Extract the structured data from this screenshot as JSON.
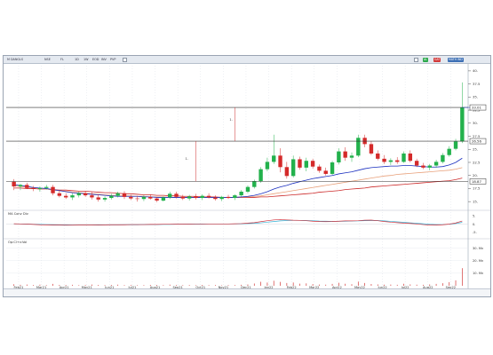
{
  "toolbar": {
    "symbol": "M DANGLS",
    "exchange": "NSE",
    "timeframe": "FL",
    "opts": [
      "1D",
      "1W",
      "EOD",
      "INV",
      "PVP"
    ],
    "badges": [
      {
        "label": "AL",
        "color": "#2aa84a"
      },
      {
        "label": "GAT",
        "color": "#d23a3a"
      },
      {
        "label": "MATH IND",
        "color": "#3c6fb5"
      }
    ]
  },
  "chart_data": {
    "type": "candlestick",
    "months": [
      "Feb21",
      "Mar21",
      "Apr21",
      "May21",
      "Jun21",
      "Jul21",
      "Aug21",
      "Sep21",
      "Oct21",
      "Nov21",
      "Dec21",
      "Jan22",
      "Feb22",
      "Mar22",
      "Apr22",
      "May22",
      "Jun22",
      "Jul22",
      "Aug22",
      "Sep22"
    ],
    "price_ticks": [
      "40.",
      "37.5",
      "35.",
      "32.5",
      "30.",
      "27.5",
      "25.",
      "22.5",
      "20.",
      "17.5",
      "15."
    ],
    "price_labels": [
      {
        "text": "33.01",
        "color": "#1a1a1a"
      },
      {
        "text": "26.56",
        "color": "#1a1a1a"
      },
      {
        "text": "18.87",
        "color": "#1a1a1a"
      }
    ],
    "candles": [
      {
        "o": 18.8,
        "h": 19.3,
        "l": 17.2,
        "c": 17.9
      },
      {
        "o": 17.9,
        "h": 18.4,
        "l": 17.2,
        "c": 18.2
      },
      {
        "o": 18.2,
        "h": 18.6,
        "l": 17.4,
        "c": 17.6
      },
      {
        "o": 17.6,
        "h": 18.0,
        "l": 17.0,
        "c": 17.4
      },
      {
        "o": 17.4,
        "h": 17.9,
        "l": 16.9,
        "c": 17.6
      },
      {
        "o": 17.6,
        "h": 18.2,
        "l": 17.3,
        "c": 17.8
      },
      {
        "o": 17.8,
        "h": 18.2,
        "l": 16.2,
        "c": 16.6
      },
      {
        "o": 16.6,
        "h": 17.1,
        "l": 15.8,
        "c": 16.1
      },
      {
        "o": 16.1,
        "h": 16.6,
        "l": 15.5,
        "c": 15.8
      },
      {
        "o": 15.8,
        "h": 16.6,
        "l": 15.3,
        "c": 16.2
      },
      {
        "o": 16.2,
        "h": 16.9,
        "l": 15.8,
        "c": 16.6
      },
      {
        "o": 16.6,
        "h": 17.0,
        "l": 15.9,
        "c": 16.2
      },
      {
        "o": 16.2,
        "h": 16.8,
        "l": 15.4,
        "c": 15.8
      },
      {
        "o": 15.8,
        "h": 16.4,
        "l": 15.0,
        "c": 15.4
      },
      {
        "o": 15.4,
        "h": 16.0,
        "l": 15.0,
        "c": 15.7
      },
      {
        "o": 15.7,
        "h": 16.5,
        "l": 15.4,
        "c": 16.1
      },
      {
        "o": 16.1,
        "h": 16.9,
        "l": 15.8,
        "c": 16.6
      },
      {
        "o": 16.6,
        "h": 17.0,
        "l": 15.5,
        "c": 15.9
      },
      {
        "o": 15.9,
        "h": 16.3,
        "l": 15.3,
        "c": 15.6
      },
      {
        "o": 15.6,
        "h": 16.1,
        "l": 15.0,
        "c": 15.5
      },
      {
        "o": 15.5,
        "h": 16.2,
        "l": 15.1,
        "c": 15.9
      },
      {
        "o": 15.9,
        "h": 16.4,
        "l": 15.4,
        "c": 15.6
      },
      {
        "o": 15.6,
        "h": 15.9,
        "l": 14.9,
        "c": 15.2
      },
      {
        "o": 15.2,
        "h": 16.0,
        "l": 15.0,
        "c": 15.8
      },
      {
        "o": 15.8,
        "h": 16.9,
        "l": 15.5,
        "c": 16.5
      },
      {
        "o": 16.5,
        "h": 16.9,
        "l": 15.6,
        "c": 15.9
      },
      {
        "o": 15.9,
        "h": 16.3,
        "l": 15.3,
        "c": 15.6
      },
      {
        "o": 15.6,
        "h": 16.3,
        "l": 15.2,
        "c": 16.0
      },
      {
        "o": 16.0,
        "h": 16.5,
        "l": 15.4,
        "c": 15.7
      },
      {
        "o": 15.7,
        "h": 16.4,
        "l": 15.3,
        "c": 16.1
      },
      {
        "o": 16.1,
        "h": 16.6,
        "l": 15.6,
        "c": 15.8
      },
      {
        "o": 15.8,
        "h": 16.2,
        "l": 15.2,
        "c": 15.5
      },
      {
        "o": 15.5,
        "h": 16.1,
        "l": 15.1,
        "c": 15.9
      },
      {
        "o": 15.9,
        "h": 16.3,
        "l": 15.5,
        "c": 15.7
      },
      {
        "o": 15.7,
        "h": 16.4,
        "l": 15.3,
        "c": 16.2
      },
      {
        "o": 16.2,
        "h": 17.2,
        "l": 15.9,
        "c": 16.9
      },
      {
        "o": 16.9,
        "h": 18.1,
        "l": 16.6,
        "c": 17.8
      },
      {
        "o": 17.8,
        "h": 19.2,
        "l": 17.5,
        "c": 18.9
      },
      {
        "o": 18.9,
        "h": 21.6,
        "l": 18.6,
        "c": 21.2
      },
      {
        "o": 21.2,
        "h": 23.4,
        "l": 20.8,
        "c": 22.6
      },
      {
        "o": 22.6,
        "h": 27.8,
        "l": 22.2,
        "c": 23.8
      },
      {
        "o": 23.8,
        "h": 25.2,
        "l": 20.6,
        "c": 21.6
      },
      {
        "o": 21.6,
        "h": 22.6,
        "l": 19.4,
        "c": 19.9
      },
      {
        "o": 19.9,
        "h": 23.8,
        "l": 19.6,
        "c": 23.1
      },
      {
        "o": 23.1,
        "h": 23.6,
        "l": 21.1,
        "c": 21.5
      },
      {
        "o": 21.5,
        "h": 23.4,
        "l": 20.8,
        "c": 22.8
      },
      {
        "o": 22.8,
        "h": 23.2,
        "l": 21.3,
        "c": 21.7
      },
      {
        "o": 21.7,
        "h": 22.1,
        "l": 20.5,
        "c": 20.9
      },
      {
        "o": 20.9,
        "h": 21.5,
        "l": 20.0,
        "c": 20.3
      },
      {
        "o": 20.3,
        "h": 22.8,
        "l": 20.1,
        "c": 22.5
      },
      {
        "o": 22.5,
        "h": 25.2,
        "l": 22.1,
        "c": 24.6
      },
      {
        "o": 24.6,
        "h": 25.4,
        "l": 22.8,
        "c": 23.4
      },
      {
        "o": 23.4,
        "h": 24.4,
        "l": 22.6,
        "c": 23.8
      },
      {
        "o": 23.8,
        "h": 27.8,
        "l": 23.5,
        "c": 27.2
      },
      {
        "o": 27.2,
        "h": 27.8,
        "l": 25.4,
        "c": 26.0
      },
      {
        "o": 26.0,
        "h": 26.5,
        "l": 23.9,
        "c": 24.2
      },
      {
        "o": 24.2,
        "h": 24.8,
        "l": 22.9,
        "c": 23.2
      },
      {
        "o": 23.2,
        "h": 23.9,
        "l": 22.2,
        "c": 22.6
      },
      {
        "o": 22.6,
        "h": 23.3,
        "l": 22.0,
        "c": 22.9
      },
      {
        "o": 22.9,
        "h": 23.5,
        "l": 22.2,
        "c": 22.6
      },
      {
        "o": 22.6,
        "h": 24.6,
        "l": 22.4,
        "c": 24.2
      },
      {
        "o": 24.2,
        "h": 24.8,
        "l": 22.5,
        "c": 22.8
      },
      {
        "o": 22.8,
        "h": 23.2,
        "l": 21.6,
        "c": 21.9
      },
      {
        "o": 21.9,
        "h": 22.4,
        "l": 21.2,
        "c": 21.5
      },
      {
        "o": 21.5,
        "h": 22.2,
        "l": 21.0,
        "c": 21.9
      },
      {
        "o": 21.9,
        "h": 23.0,
        "l": 21.5,
        "c": 22.6
      },
      {
        "o": 22.6,
        "h": 24.3,
        "l": 22.3,
        "c": 23.9
      },
      {
        "o": 23.9,
        "h": 25.6,
        "l": 23.6,
        "c": 25.1
      },
      {
        "o": 25.1,
        "h": 27.0,
        "l": 24.8,
        "c": 26.5
      },
      {
        "o": 26.5,
        "h": 37.8,
        "l": 26.2,
        "c": 33.0
      }
    ],
    "ma_fast": [
      18.2,
      18.1,
      17.9,
      17.7,
      17.6,
      17.5,
      17.3,
      17.1,
      16.9,
      16.7,
      16.6,
      16.5,
      16.4,
      16.3,
      16.2,
      16.1,
      16.0,
      16.0,
      16.0,
      16.0,
      15.9,
      15.9,
      15.8,
      15.8,
      15.8,
      15.8,
      15.8,
      15.8,
      15.8,
      15.8,
      15.8,
      15.8,
      15.8,
      15.8,
      15.8,
      15.9,
      16.0,
      16.2,
      16.5,
      16.9,
      17.4,
      17.8,
      18.1,
      18.5,
      18.8,
      19.1,
      19.4,
      19.6,
      19.8,
      20.0,
      20.3,
      20.5,
      20.7,
      21.0,
      21.3,
      21.5,
      21.6,
      21.7,
      21.8,
      21.8,
      21.9,
      21.9,
      21.8,
      21.7,
      21.6,
      21.6,
      21.7,
      22.0,
      22.5,
      23.3
    ],
    "ma_slow": [
      18.0,
      17.9,
      17.8,
      17.6,
      17.5,
      17.4,
      17.2,
      17.1,
      17.0,
      16.8,
      16.7,
      16.6,
      16.5,
      16.4,
      16.3,
      16.2,
      16.2,
      16.1,
      16.1,
      16.0,
      16.0,
      15.9,
      15.9,
      15.9,
      15.8,
      15.8,
      15.8,
      15.8,
      15.8,
      15.8,
      15.8,
      15.8,
      15.8,
      15.8,
      15.8,
      15.9,
      15.9,
      16.0,
      16.1,
      16.3,
      16.5,
      16.7,
      16.9,
      17.1,
      17.3,
      17.5,
      17.7,
      17.9,
      18.1,
      18.3,
      18.5,
      18.7,
      18.9,
      19.1,
      19.3,
      19.5,
      19.7,
      19.9,
      20.0,
      20.2,
      20.3,
      20.4,
      20.5,
      20.6,
      20.7,
      20.8,
      20.9,
      21.0,
      21.2,
      21.5
    ],
    "ma_long": [
      17.6,
      17.6,
      17.5,
      17.5,
      17.4,
      17.4,
      17.3,
      17.2,
      17.2,
      17.1,
      17.0,
      17.0,
      16.9,
      16.8,
      16.7,
      16.7,
      16.6,
      16.5,
      16.5,
      16.4,
      16.3,
      16.3,
      16.2,
      16.2,
      16.1,
      16.1,
      16.0,
      16.0,
      16.0,
      15.9,
      15.9,
      15.9,
      15.8,
      15.8,
      15.8,
      15.8,
      15.8,
      15.8,
      15.9,
      15.9,
      16.0,
      16.1,
      16.2,
      16.3,
      16.4,
      16.5,
      16.6,
      16.8,
      16.9,
      17.0,
      17.1,
      17.3,
      17.4,
      17.5,
      17.6,
      17.8,
      17.9,
      18.0,
      18.1,
      18.2,
      18.3,
      18.4,
      18.5,
      18.6,
      18.7,
      18.8,
      18.9,
      19.0,
      19.2,
      19.5
    ],
    "osc_label": "MA Conv Div",
    "osc_ticks": [
      "5.",
      "0.",
      "-5."
    ],
    "osc_line1": [
      0.2,
      0.1,
      0.0,
      -0.2,
      -0.4,
      -0.5,
      -0.6,
      -0.6,
      -0.7,
      -0.7,
      -0.6,
      -0.6,
      -0.6,
      -0.5,
      -0.5,
      -0.4,
      -0.4,
      -0.4,
      -0.3,
      -0.3,
      -0.3,
      -0.2,
      -0.2,
      -0.1,
      -0.1,
      0.0,
      0.0,
      0.0,
      0.1,
      0.1,
      0.1,
      0.1,
      0.1,
      0.1,
      0.2,
      0.3,
      0.6,
      0.9,
      1.5,
      2.1,
      2.6,
      2.8,
      2.6,
      2.4,
      2.3,
      2.1,
      1.8,
      1.6,
      1.5,
      1.6,
      1.8,
      2.0,
      2.0,
      2.1,
      2.4,
      2.5,
      2.1,
      1.6,
      1.2,
      0.9,
      0.6,
      0.4,
      0.1,
      -0.3,
      -0.6,
      -0.6,
      -0.4,
      0.0,
      0.7,
      1.9
    ],
    "osc_line2": [
      0.1,
      0.1,
      0.0,
      -0.1,
      -0.2,
      -0.3,
      -0.4,
      -0.5,
      -0.5,
      -0.6,
      -0.6,
      -0.6,
      -0.6,
      -0.6,
      -0.5,
      -0.5,
      -0.5,
      -0.4,
      -0.4,
      -0.4,
      -0.3,
      -0.3,
      -0.3,
      -0.2,
      -0.2,
      -0.1,
      -0.1,
      0.0,
      0.0,
      0.0,
      0.1,
      0.1,
      0.1,
      0.1,
      0.1,
      0.2,
      0.3,
      0.5,
      0.8,
      1.2,
      1.6,
      2.0,
      2.2,
      2.3,
      2.3,
      2.2,
      2.1,
      1.9,
      1.8,
      1.7,
      1.7,
      1.8,
      1.9,
      2.0,
      2.1,
      2.2,
      2.2,
      2.0,
      1.7,
      1.4,
      1.1,
      0.8,
      0.5,
      0.2,
      -0.1,
      -0.3,
      -0.3,
      -0.1,
      0.3,
      1.1
    ],
    "vol_label": "Op:Cl+v:Vol",
    "vol_ticks": [
      "30. Mn",
      "20. Mn",
      "10. Mn"
    ],
    "volumes": [
      1.2,
      0.8,
      1.0,
      0.6,
      0.9,
      0.5,
      1.5,
      0.7,
      0.6,
      0.8,
      0.5,
      0.6,
      1.0,
      0.7,
      0.5,
      0.6,
      0.9,
      0.5,
      0.6,
      0.4,
      0.5,
      0.7,
      0.6,
      0.5,
      0.9,
      0.6,
      0.5,
      0.6,
      0.4,
      0.7,
      0.5,
      0.6,
      0.4,
      0.5,
      0.6,
      0.8,
      1.1,
      1.8,
      3.2,
      2.6,
      4.0,
      3.1,
      2.2,
      2.6,
      1.7,
      1.9,
      1.3,
      1.0,
      0.9,
      1.5,
      2.4,
      1.6,
      1.2,
      3.3,
      2.2,
      1.4,
      1.1,
      0.9,
      1.0,
      0.8,
      1.6,
      1.1,
      0.9,
      0.8,
      1.1,
      1.5,
      2.0,
      2.9,
      4.3,
      14.0
    ],
    "annotations": [
      "1.",
      "1."
    ]
  }
}
